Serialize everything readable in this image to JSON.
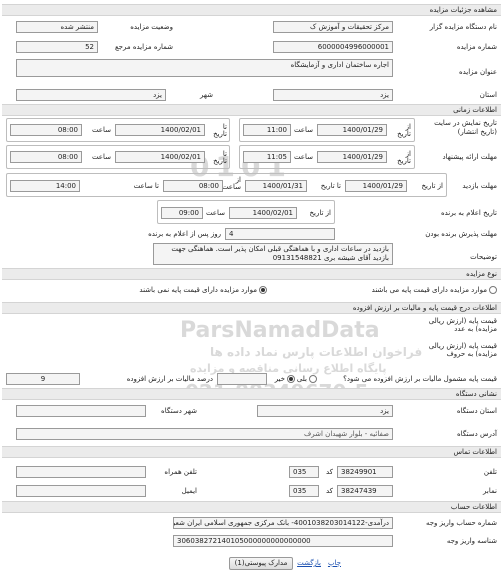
{
  "page_title": "مشاهده جزئیات مزایده",
  "organizer_label": "نام دستگاه مزایده گزار",
  "organizer_value": "مرکز تحقیقات و آموزش ک",
  "status_label": "وضعیت مزایده",
  "status_value": "منتشر شده",
  "auction_number_label": "شماره مزایده",
  "auction_number_value": "6000004996000001",
  "ref_number_label": "شماره مزایده مرجع",
  "ref_number_value": "52",
  "title_label": "عنوان مزایده",
  "title_value": "اجاره ساختمان اداری و آزمایشگاه",
  "province_label": "استان",
  "province_value": "یزد",
  "city_label": "شهر",
  "city_value": "یزد",
  "timing_section": "اطلاعات زمانی",
  "display_label": "تاریخ نمایش در سایت (تاریخ انتشار)",
  "from_date_label": "از تاریخ",
  "to_date_label": "تا تاریخ",
  "time_label": "ساعت",
  "display_from_date": "1400/01/29",
  "display_from_time": "11:00",
  "display_to_date": "1400/02/01",
  "display_to_time": "08:00",
  "offer_label": "مهلت ارائه پیشنهاد",
  "offer_from_date": "1400/01/29",
  "offer_from_time": "11:05",
  "offer_to_date": "1400/02/01",
  "offer_to_time": "08:00",
  "visit_label": "مهلت بازدید",
  "visit_from_date_label": "از تاریخ",
  "visit_to_date_label": "تا تاریخ",
  "visit_from_time_label": "از ساعت",
  "visit_to_time_label": "تا ساعت",
  "visit_from_date": "1400/01/29",
  "visit_to_date": "1400/01/31",
  "visit_from_time": "08:00",
  "visit_to_time": "14:00",
  "winner_announce_label": "تاریخ اعلام به برنده",
  "winner_from_label": "از تاریخ",
  "winner_date": "1400/02/01",
  "winner_time": "09:00",
  "acceptance_label": "مهلت پذیرش برنده بودن",
  "acceptance_value": "4",
  "acceptance_suffix": "روز پس از اعلام به برنده",
  "description_label": "توضیحات",
  "description_value": "بازدید در ساعات اداری و با هماهنگی قبلی امکان پذیر است. هماهنگی جهت بازدید آقای شیشه بری 09131548821",
  "auction_type_section": "نوع مزایده",
  "type_option_with_price": "موارد مزایده دارای قیمت پایه می باشند",
  "type_option_without_price": "موارد مزایده دارای قیمت پایه نمی باشند",
  "price_section": "اطلاعات درج قیمت پایه و مالیات بر ارزش افزوده",
  "base_price_number_label": "قیمت پایه (ارزش ریالی مزایده) به عدد",
  "base_price_text_label": "قیمت پایه (ارزش ریالی مزایده) به حروف",
  "vat_question": "قیمت پایه مشمول مالیات بر ارزش افزوده می شود؟",
  "vat_yes": "بلی",
  "vat_no": "خیر",
  "vat_percent_label": "درصد مالیات بر ارزش افزوده",
  "vat_percent_value": "9",
  "address_section": "نشانی دستگاه",
  "org_province_label": "استان دستگاه",
  "org_province_value": "یزد",
  "org_city_label": "شهر دستگاه",
  "org_address_label": "آدرس دستگاه",
  "org_address_value": "صفائیه - بلوار شهیدان اشرف",
  "contact_section": "اطلاعات تماس",
  "phone_label": "تلفن",
  "phone_value": "38249901",
  "phone_code": "035",
  "code_label": "کد",
  "mobile_label": "تلفن همراه",
  "fax_label": "نمابر",
  "fax_value": "38247439",
  "fax_code": "035",
  "email_label": "ایمیل",
  "account_section": "اطلاعات حساب",
  "account_number_label": "شماره حساب واریز وجه",
  "account_number_value": "درآمدی-4001038203014122- بانک مرکزی جمهوری اسلامی ایران شعبه مرکزی",
  "sheba_label": "شناسه واریز وجه",
  "sheba_value": "306038272140105000000000000000",
  "attachments_link": "مدارک پیوستی(1)",
  "return_link": "بازگشت",
  "print_link": "چاپ"
}
